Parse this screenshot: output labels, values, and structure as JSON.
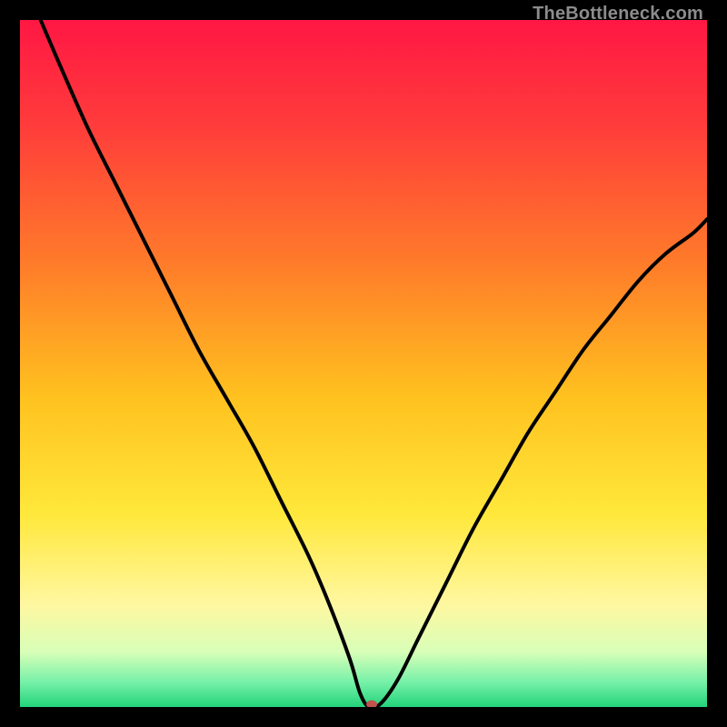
{
  "watermark": "TheBottleneck.com",
  "chart_data": {
    "type": "line",
    "title": "",
    "xlabel": "",
    "ylabel": "",
    "xlim": [
      0,
      100
    ],
    "ylim": [
      0,
      100
    ],
    "grid": false,
    "legend": false,
    "background_gradient": {
      "stops": [
        {
          "offset": 0.0,
          "color": "#ff1744"
        },
        {
          "offset": 0.15,
          "color": "#ff3b3b"
        },
        {
          "offset": 0.35,
          "color": "#ff7a2a"
        },
        {
          "offset": 0.55,
          "color": "#ffc21f"
        },
        {
          "offset": 0.72,
          "color": "#ffe83b"
        },
        {
          "offset": 0.85,
          "color": "#fff7a0"
        },
        {
          "offset": 0.92,
          "color": "#d8ffb8"
        },
        {
          "offset": 0.965,
          "color": "#74f0a8"
        },
        {
          "offset": 1.0,
          "color": "#22d37a"
        }
      ]
    },
    "curve": {
      "description": "V-shaped bottleneck curve descending from top-left, reaching zero near x≈51, then rising toward the right edge reaching ~70%",
      "x": [
        3,
        6,
        10,
        14,
        18,
        22,
        26,
        30,
        34,
        38,
        42,
        45,
        48,
        49.5,
        50.8,
        52.5,
        55,
        58,
        62,
        66,
        70,
        74,
        78,
        82,
        86,
        90,
        94,
        98,
        100
      ],
      "y": [
        100,
        93,
        84,
        76,
        68,
        60,
        52,
        45,
        38,
        30,
        22,
        15,
        7,
        2,
        0,
        0.5,
        4,
        10,
        18,
        26,
        33,
        40,
        46,
        52,
        57,
        62,
        66,
        69,
        71
      ]
    },
    "marker": {
      "x": 51.2,
      "y": 0,
      "color": "#c0534e",
      "rx": 6,
      "ry": 4.5
    }
  }
}
